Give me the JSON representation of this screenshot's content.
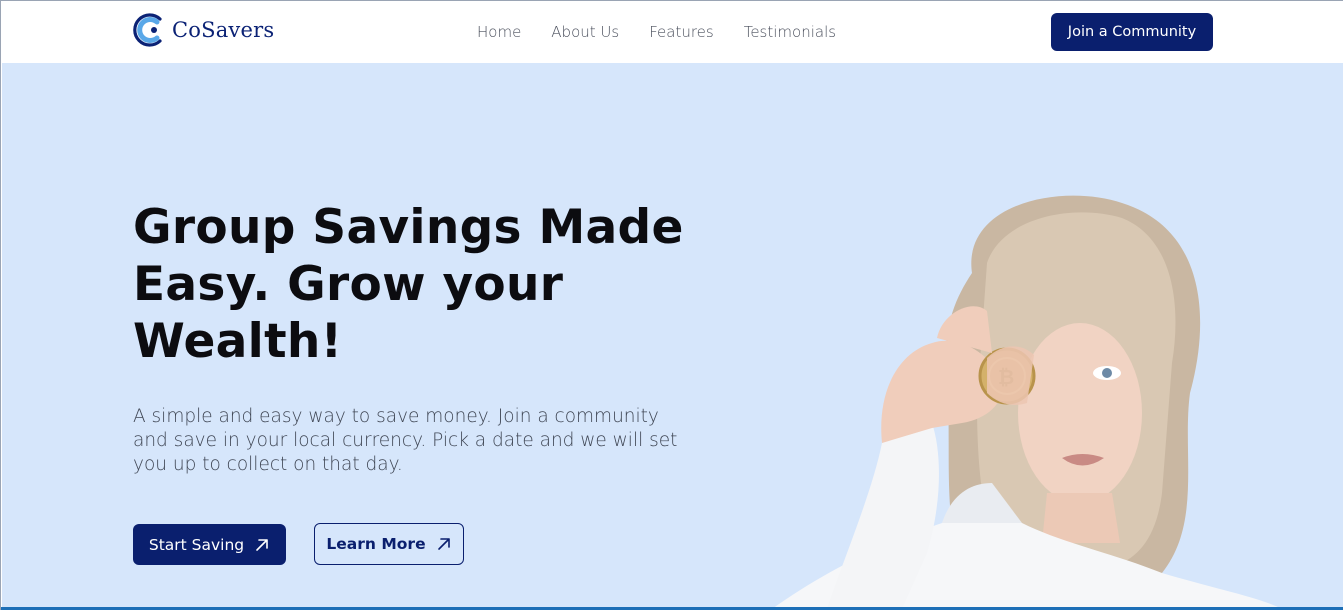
{
  "brand": {
    "name": "CoSavers",
    "logo_icon": "c-logo-icon",
    "color": "#0a1f6e"
  },
  "nav": {
    "links": [
      "Home",
      "About Us",
      "Features",
      "Testimonials"
    ],
    "cta": "Join a Community"
  },
  "hero": {
    "title": "Group Savings Made Easy. Grow your Wealth!",
    "description": "A simple and easy way to save money. Join a community and save in your local currency. Pick a date and we will set you up to collect on that day.",
    "primary_button": "Start Saving",
    "secondary_button": "Learn More",
    "button_icon": "arrow-up-right-icon",
    "background": "#d6e6fb",
    "image": "woman-holding-bitcoin-image"
  }
}
